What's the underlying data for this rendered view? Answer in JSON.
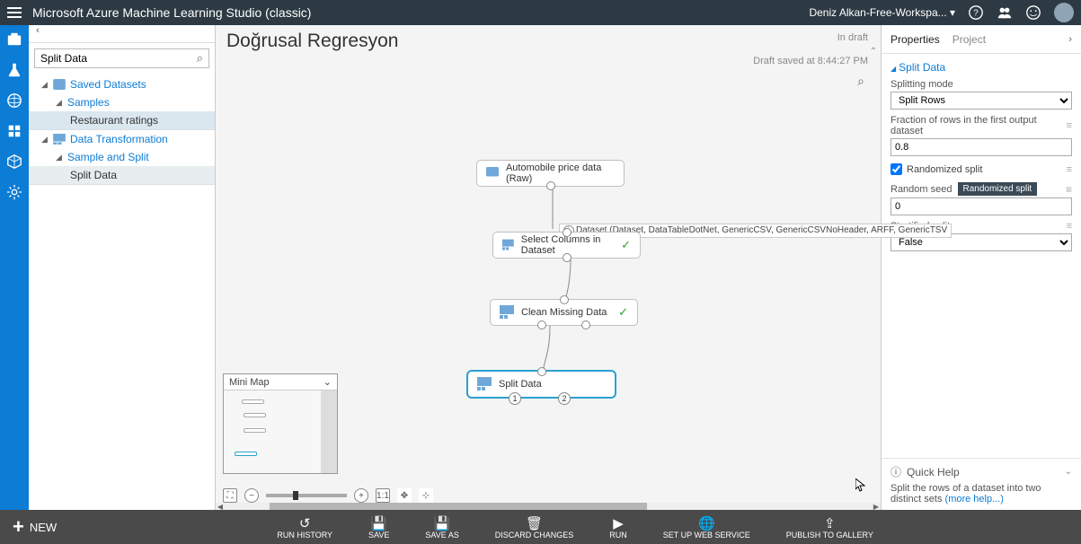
{
  "topbar": {
    "title": "Microsoft Azure Machine Learning Studio (classic)",
    "workspace": "Deniz Alkan-Free-Workspa... ▾"
  },
  "palette": {
    "search_value": "Split Data",
    "groups": {
      "g1": {
        "label": "Saved Datasets"
      },
      "g1s1": {
        "label": "Samples"
      },
      "g1s1i1": {
        "label": "Restaurant ratings"
      },
      "g2": {
        "label": "Data Transformation"
      },
      "g2s1": {
        "label": "Sample and Split"
      },
      "g2s1i1": {
        "label": "Split Data"
      }
    }
  },
  "canvas": {
    "title": "Doğrusal Regresyon",
    "draft": "In draft",
    "saved": "Draft saved at 8:44:27 PM",
    "tooltip": "Dataset (Dataset, DataTableDotNet, GenericCSV, GenericCSVNoHeader, ARFF, GenericTSV",
    "nodes": {
      "n1": "Automobile price data (Raw)",
      "n2": "Select Columns in Dataset",
      "n3": "Clean Missing Data",
      "n4": "Split Data"
    },
    "ports": {
      "p1": "1",
      "p2": "2"
    },
    "minimap": "Mini Map",
    "zoom": {
      "fit": "[ ]",
      "one": "1:1"
    }
  },
  "props": {
    "tabs": {
      "properties": "Properties",
      "project": "Project"
    },
    "section": "Split Data",
    "fields": {
      "mode_label": "Splitting mode",
      "mode_value": "Split Rows",
      "fraction_label": "Fraction of rows in the first output dataset",
      "fraction_value": "0.8",
      "randomized_label": "Randomized split",
      "seed_label": "Random seed",
      "seed_badge": "Randomized split",
      "seed_value": "0",
      "strat_label": "Stratified split",
      "strat_value": "False"
    },
    "quickhelp": {
      "title": "Quick Help",
      "text": "Split the rows of a dataset into two distinct sets ",
      "more": "(more help...)"
    }
  },
  "bottombar": {
    "new": "NEW",
    "items": {
      "runhist": "RUN HISTORY",
      "save": "SAVE",
      "saveas": "SAVE AS",
      "discard": "DISCARD CHANGES",
      "run": "RUN",
      "setupws": "SET UP WEB SERVICE",
      "publish": "PUBLISH TO GALLERY"
    }
  }
}
